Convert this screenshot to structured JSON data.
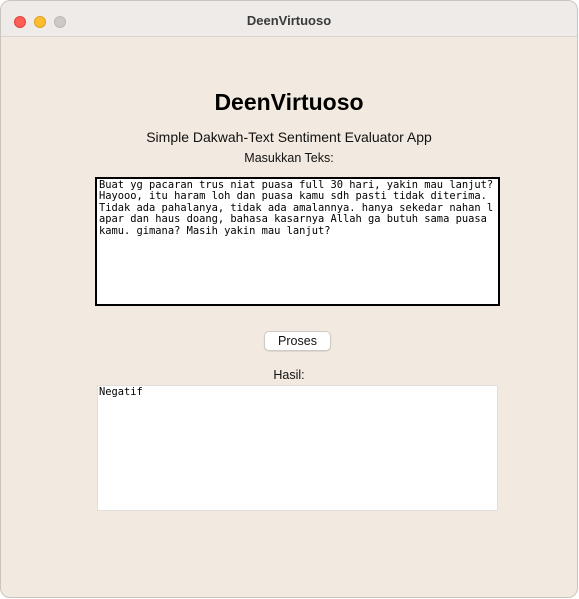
{
  "window": {
    "title": "DeenVirtuoso"
  },
  "app": {
    "title": "DeenVirtuoso",
    "subtitle": "Simple Dakwah-Text Sentiment Evaluator App",
    "input_label": "Masukkan Teks:",
    "input_text": "Buat yg pacaran trus niat puasa full 30 hari, yakin mau lanjut? Hayooo, itu haram loh dan puasa kamu sdh pasti tidak diterima. Tidak ada pahalanya, tidak ada amalannya. hanya sekedar nahan lapar dan haus doang, bahasa kasarnya Allah ga butuh sama puasa kamu. gimana? Masih yakin mau lanjut?",
    "process_button_label": "Proses",
    "result_label": "Hasil:",
    "result_text": "Negatif"
  },
  "colors": {
    "window_background": "#f2eae0",
    "close": "#fe5f57",
    "minimize": "#febc2e",
    "maximize": "#cdcac6"
  }
}
